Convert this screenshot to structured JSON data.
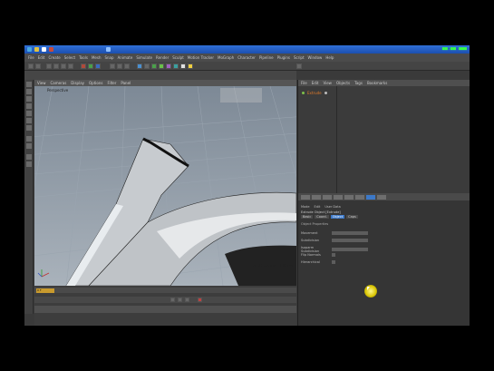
{
  "taskbar": {
    "clock": "■■:■■ ■■■"
  },
  "menubar": {
    "items": [
      "File",
      "Edit",
      "Create",
      "Select",
      "Tools",
      "Mesh",
      "Snap",
      "Animate",
      "Simulate",
      "Render",
      "Sculpt",
      "Motion Tracker",
      "MoGraph",
      "Character",
      "Pipeline",
      "Plugins",
      "Script",
      "Window",
      "Help"
    ]
  },
  "viewport": {
    "menu_items": [
      "View",
      "Cameras",
      "Display",
      "Options",
      "Filter",
      "Panel"
    ],
    "label": "Perspective",
    "hud_text": "",
    "grid_spacing": "Grid Spacing : 100 cm"
  },
  "timeline": {
    "frame_value": "0 F"
  },
  "object_manager": {
    "menu_items": [
      "File",
      "Edit",
      "View",
      "Objects",
      "Tags",
      "Bookmarks"
    ],
    "object_name": "Extrude"
  },
  "attribute_manager": {
    "menu_items": [
      "Mode",
      "Edit",
      "User Data"
    ],
    "object_label": "Extrude Object [Extrude]",
    "tabs": [
      "Basic",
      "Coord.",
      "Object",
      "Caps"
    ],
    "active_tab": "Object",
    "section_label": "Object Properties",
    "rows": [
      {
        "label": "Movement",
        "value": ""
      },
      {
        "label": "Subdivision",
        "value": ""
      },
      {
        "label": "Isoparm Subdivision",
        "value": ""
      },
      {
        "label": "Flip Normals",
        "value": ""
      },
      {
        "label": "Hierarchical",
        "value": ""
      }
    ]
  },
  "colors": {
    "accent": "#b5651d",
    "active_tab": "#3c78c8",
    "viewport_bg": "#8f9aa6",
    "object_highlight": "#e07a2a"
  }
}
